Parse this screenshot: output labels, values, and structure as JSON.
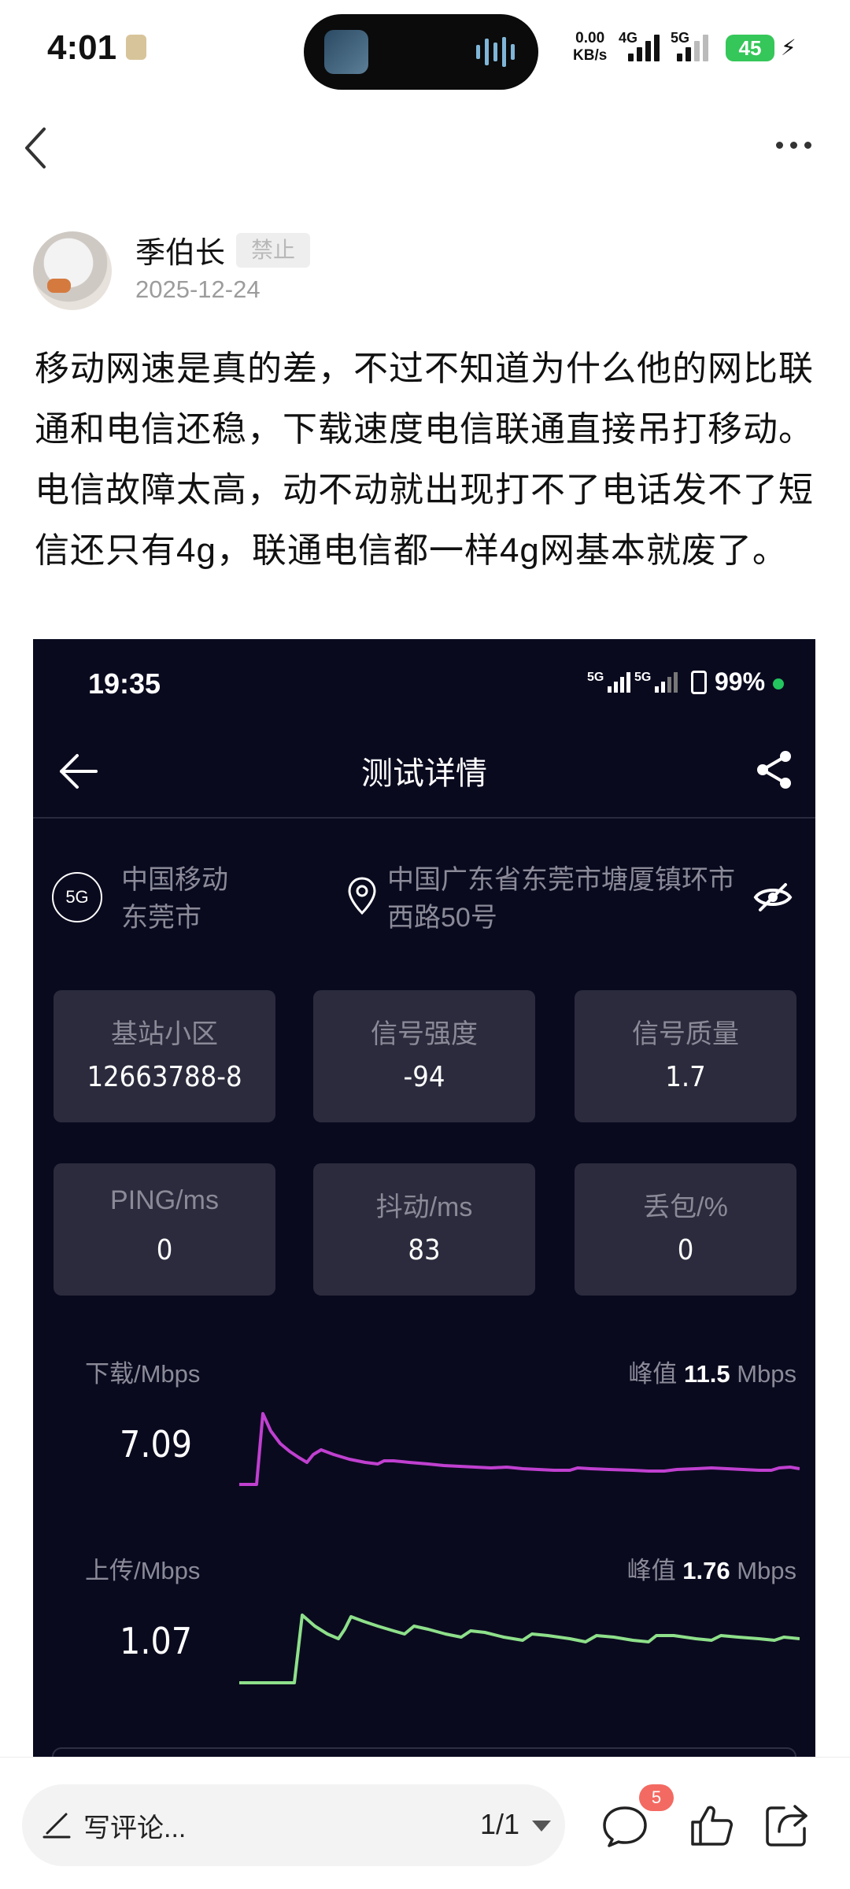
{
  "status_bar": {
    "time": "4:01",
    "speed_value": "0.00",
    "speed_unit": "KB/s",
    "net1": "4G",
    "net2": "5G",
    "battery": "45"
  },
  "post": {
    "author": "季伯长",
    "tag": "禁止",
    "date": "2025-12-24",
    "text": "移动网速是真的差，不过不知道为什么他的网比联通和电信还稳，下载速度电信联通直接吊打移动。电信故障太高，动不动就出现打不了电话发不了短信还只有4g，联通电信都一样4g网基本就废了。"
  },
  "embedded": {
    "time": "19:35",
    "sig1": "5G",
    "sig2": "5G",
    "battery_pct": "99%",
    "title": "测试详情",
    "network_badge": "5G",
    "operator_line1": "中国移动",
    "operator_line2": "东莞市",
    "location": "中国广东省东莞市塘厦镇环市西路50号",
    "cards": [
      {
        "label": "基站小区",
        "value": "12663788-8"
      },
      {
        "label": "信号强度",
        "value": "-94"
      },
      {
        "label": "信号质量",
        "value": "1.7"
      },
      {
        "label": "PING/ms",
        "value": "0"
      },
      {
        "label": "抖动/ms",
        "value": "83"
      },
      {
        "label": "丢包/%",
        "value": "0"
      }
    ],
    "download": {
      "label": "下载/Mbps",
      "peak_prefix": "峰值",
      "peak_value": "11.5",
      "peak_unit": "Mbps",
      "current": "7.09",
      "color": "#c040d0"
    },
    "upload": {
      "label": "上传/Mbps",
      "peak_prefix": "峰值",
      "peak_value": "1.76",
      "peak_unit": "Mbps",
      "current": "1.07",
      "color": "#8ee08a"
    }
  },
  "bottom_bar": {
    "comment_placeholder": "写评论...",
    "pager": "1/1",
    "comment_count": "5",
    "icons": [
      "pen-icon",
      "comment-icon",
      "like-icon",
      "share-icon"
    ]
  }
}
